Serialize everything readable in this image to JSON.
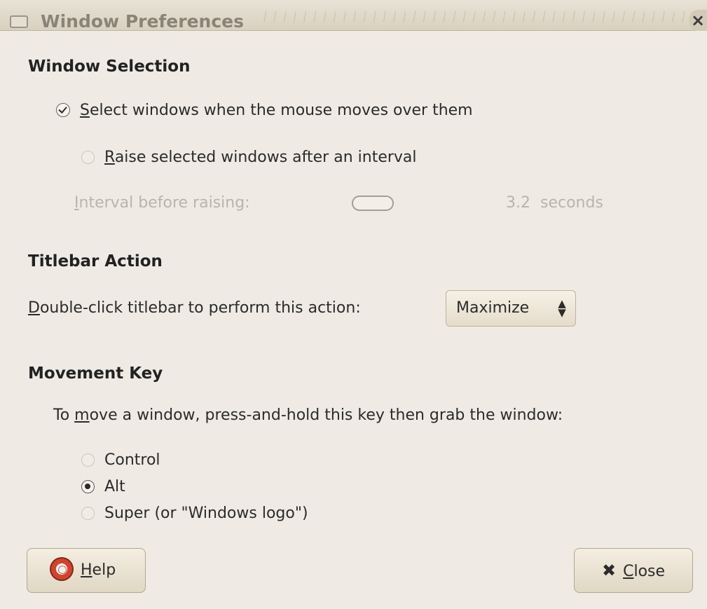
{
  "window": {
    "title": "Window Preferences",
    "close_glyph": "×"
  },
  "window_selection": {
    "heading": "Window Selection",
    "select_on_hover": {
      "mnemonic": "S",
      "rest": "elect windows when the mouse moves over them",
      "checked": true
    },
    "raise_after_interval": {
      "mnemonic": "R",
      "rest": "aise selected windows after an interval",
      "enabled": false
    },
    "interval": {
      "mnemonic": "I",
      "rest": "nterval before raising:",
      "value": "3.2",
      "unit": "seconds",
      "enabled": false
    }
  },
  "titlebar_action": {
    "heading": "Titlebar Action",
    "label_mnemonic": "D",
    "label_rest": "ouble-click titlebar to perform this action:",
    "selected": "Maximize"
  },
  "movement_key": {
    "heading": "Movement Key",
    "prompt_start": "To ",
    "prompt_mnemonic": "m",
    "prompt_rest": "ove a window, press-and-hold this key then grab the window:",
    "options": [
      {
        "label": "Control",
        "selected": false
      },
      {
        "label": "Alt",
        "selected": true
      },
      {
        "label": "Super (or \"Windows logo\")",
        "selected": false
      }
    ]
  },
  "buttons": {
    "help_mnemonic": "H",
    "help_rest": "elp",
    "close_glyph": "✖",
    "close_mnemonic": "C",
    "close_rest": "lose"
  }
}
